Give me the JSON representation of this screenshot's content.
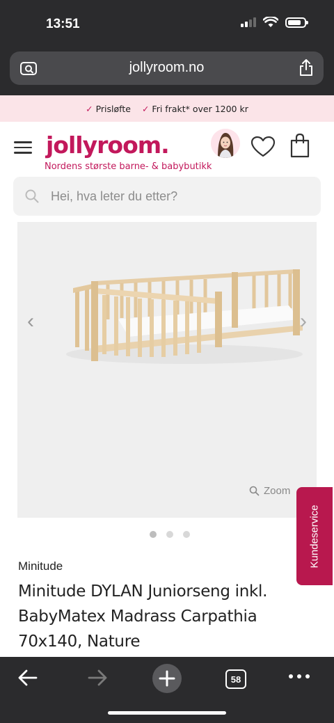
{
  "status": {
    "time": "13:51"
  },
  "browser": {
    "url": "jollyroom.no",
    "tabs_count": "58"
  },
  "promo": {
    "item1": "Prisløfte",
    "item2": "Fri frakt* over 1200 kr"
  },
  "header": {
    "logo": "jollyroom.",
    "tagline": "Nordens største barne- & babybutikk"
  },
  "search": {
    "placeholder": "Hei, hva leter du etter?"
  },
  "gallery": {
    "zoom_label": "Zoom",
    "slide_count": 3,
    "active_slide": 1
  },
  "product": {
    "brand": "Minitude",
    "title": "Minitude DYLAN Juniorseng inkl. BabyMatex Madrass Carpathia 70x140, Nature"
  },
  "support": {
    "label": "Kundeservice"
  },
  "colors": {
    "brand": "#c2185b",
    "chrome": "#2b2b2d",
    "promo_bg": "#fbe4e8"
  }
}
